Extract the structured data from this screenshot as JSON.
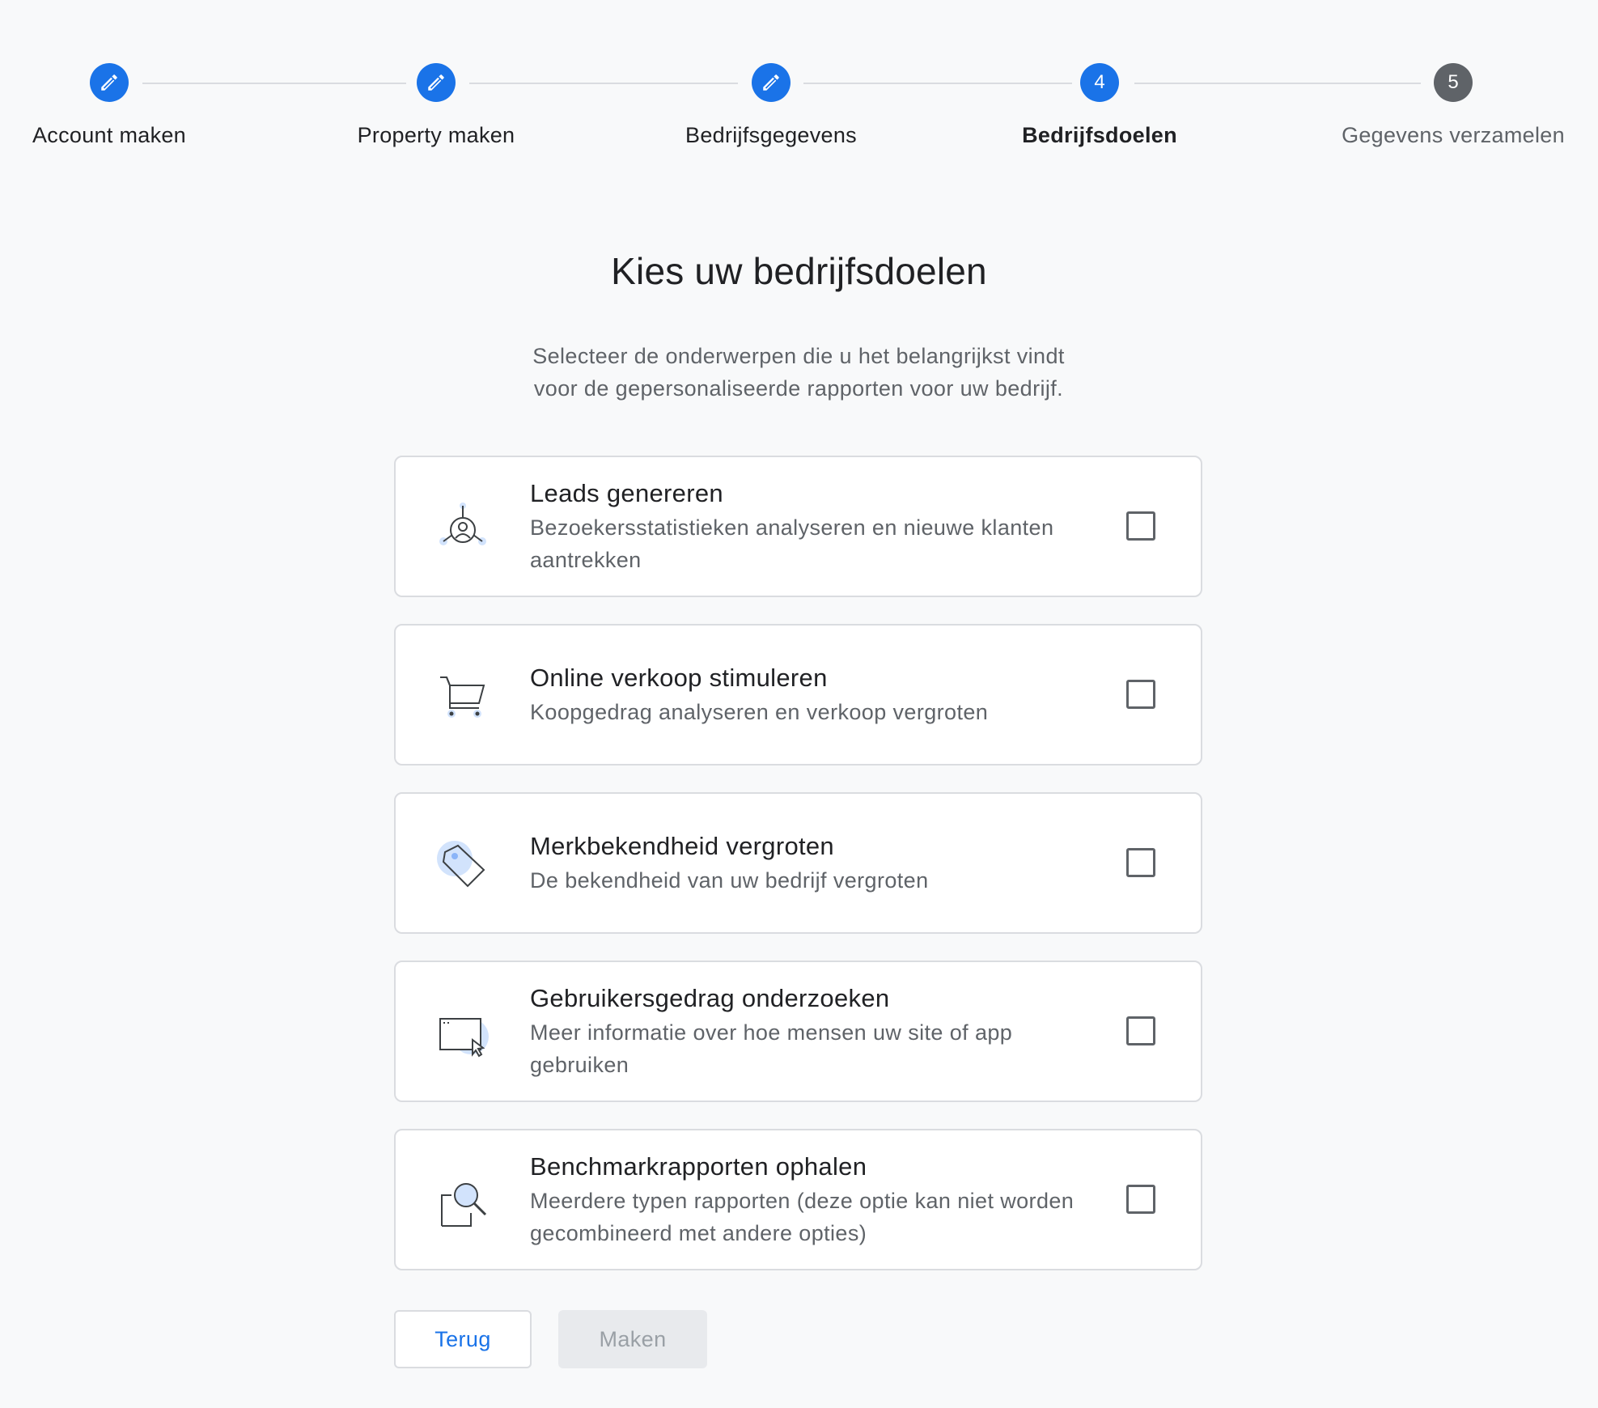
{
  "stepper": {
    "steps": [
      {
        "label": "Account maken",
        "state": "done",
        "icon": "pencil-icon"
      },
      {
        "label": "Property maken",
        "state": "done",
        "icon": "pencil-icon"
      },
      {
        "label": "Bedrijfsgegevens",
        "state": "done",
        "icon": "pencil-icon"
      },
      {
        "label": "Bedrijfsdoelen",
        "state": "active",
        "number": "4"
      },
      {
        "label": "Gegevens verzamelen",
        "state": "pending",
        "number": "5"
      }
    ]
  },
  "main": {
    "title": "Kies uw bedrijfsdoelen",
    "subtitle_line1": "Selecteer de onderwerpen die u het belangrijkst vindt",
    "subtitle_line2": "voor de gepersonaliseerde rapporten voor uw bedrijf."
  },
  "options": [
    {
      "title": "Leads genereren",
      "description": "Bezoekersstatistieken analyseren en nieuwe klanten aantrekken",
      "icon": "leads-person-icon",
      "checked": false
    },
    {
      "title": "Online verkoop stimuleren",
      "description": "Koopgedrag analyseren en verkoop vergroten",
      "icon": "shopping-cart-icon",
      "checked": false
    },
    {
      "title": "Merkbekendheid vergroten",
      "description": "De bekendheid van uw bedrijf vergroten",
      "icon": "price-tag-icon",
      "checked": false
    },
    {
      "title": "Gebruikersgedrag onderzoeken",
      "description": "Meer informatie over hoe mensen uw site of app gebruiken",
      "icon": "browser-cursor-icon",
      "checked": false
    },
    {
      "title": "Benchmarkrapporten ophalen",
      "description": "Meerdere typen rapporten (deze optie kan niet worden gecombineerd met andere opties)",
      "icon": "magnifier-report-icon",
      "checked": false
    }
  ],
  "actions": {
    "back_label": "Terug",
    "create_label": "Maken"
  },
  "colors": {
    "accent": "#1a73e8",
    "pending": "#5f6368",
    "background": "#f8f9fa",
    "icon_highlight": "#d2e3fc"
  }
}
